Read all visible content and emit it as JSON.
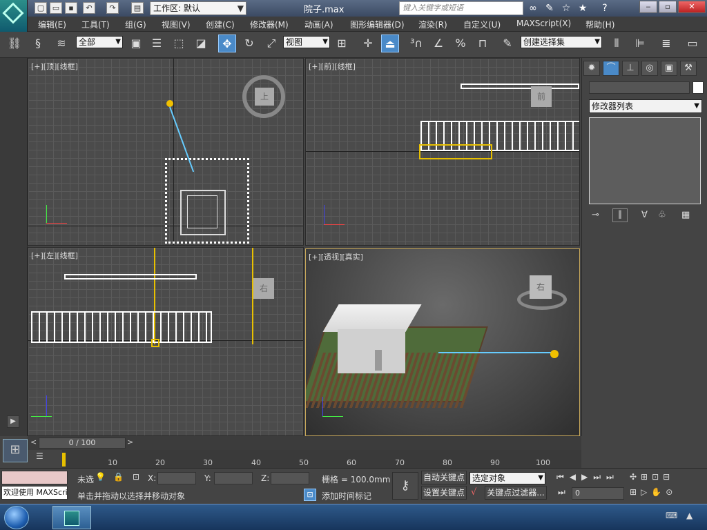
{
  "titlebar": {
    "workspace": "工作区: 默认",
    "document_title": "院子.max",
    "search_placeholder": "键入关键字或短语"
  },
  "menu": [
    "编辑(E)",
    "工具(T)",
    "组(G)",
    "视图(V)",
    "创建(C)",
    "修改器(M)",
    "动画(A)",
    "图形编辑器(D)",
    "渲染(R)",
    "自定义(U)",
    "MAXScript(X)",
    "帮助(H)"
  ],
  "toolbar": {
    "selection_filter": "全部",
    "reference_coord": "视图",
    "named_selection": "创建选择集"
  },
  "viewports": {
    "top": "[+][顶][线框]",
    "front": "[+][前][线框]",
    "left": "[+][左][线框]",
    "perspective": "[+][透视][真实]",
    "viewcube_top": "上",
    "viewcube_front": "前",
    "viewcube_left": "右",
    "viewcube_persp": "右"
  },
  "command_panel": {
    "modifier_list": "修改器列表"
  },
  "timeline": {
    "frame_counter": "0 / 100",
    "ticks": [
      "10",
      "20",
      "30",
      "40",
      "50",
      "60",
      "70",
      "80",
      "90",
      "100"
    ]
  },
  "status": {
    "maxscript_listener": "欢迎使用 MAXScri",
    "selection_status": "未选",
    "x_label": "X:",
    "y_label": "Y:",
    "z_label": "Z:",
    "grid": "栅格 = 100.0mm",
    "auto_key": "自动关键点",
    "set_key": "设置关键点",
    "key_mode": "选定对象",
    "key_filters": "关键点过滤器...",
    "prompt": "单击并拖动以选择并移动对象",
    "add_time_tag": "添加时间标记",
    "current_frame": "0"
  }
}
